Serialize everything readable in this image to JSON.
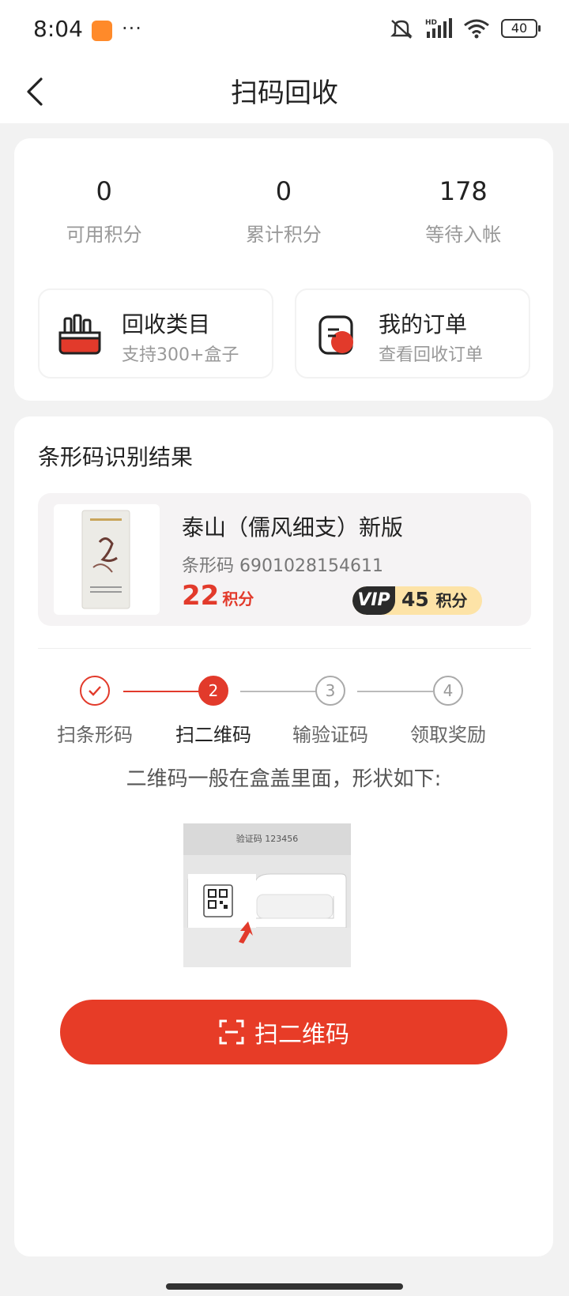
{
  "status_bar": {
    "time": "8:04",
    "more": "···",
    "battery": "40"
  },
  "nav": {
    "title": "扫码回收"
  },
  "stats": [
    {
      "value": "0",
      "label": "可用积分"
    },
    {
      "value": "0",
      "label": "累计积分"
    },
    {
      "value": "178",
      "label": "等待入帐"
    }
  ],
  "tiles": {
    "categories": {
      "title": "回收类目",
      "subtitle": "支持300+盒子"
    },
    "orders": {
      "title": "我的订单",
      "subtitle": "查看回收订单"
    }
  },
  "result": {
    "section_title": "条形码识别结果",
    "product_name": "泰山（儒风细支）新版",
    "barcode_label": "条形码 6901028154611",
    "points": "22",
    "points_unit": "积分",
    "vip_tag": "VIP",
    "vip_points": "45",
    "vip_unit": "积分"
  },
  "steps": [
    {
      "num": "",
      "label": "扫条形码",
      "state": "done"
    },
    {
      "num": "2",
      "label": "扫二维码",
      "state": "active"
    },
    {
      "num": "3",
      "label": "输验证码",
      "state": "todo"
    },
    {
      "num": "4",
      "label": "领取奖励",
      "state": "todo"
    }
  ],
  "hint": "二维码一般在盒盖里面，形状如下:",
  "illustration": {
    "code_text": "验证码 123456"
  },
  "scan_button": {
    "label": "扫二维码"
  },
  "colors": {
    "accent": "#e73c27",
    "vip_gold": "#fde3a7"
  }
}
